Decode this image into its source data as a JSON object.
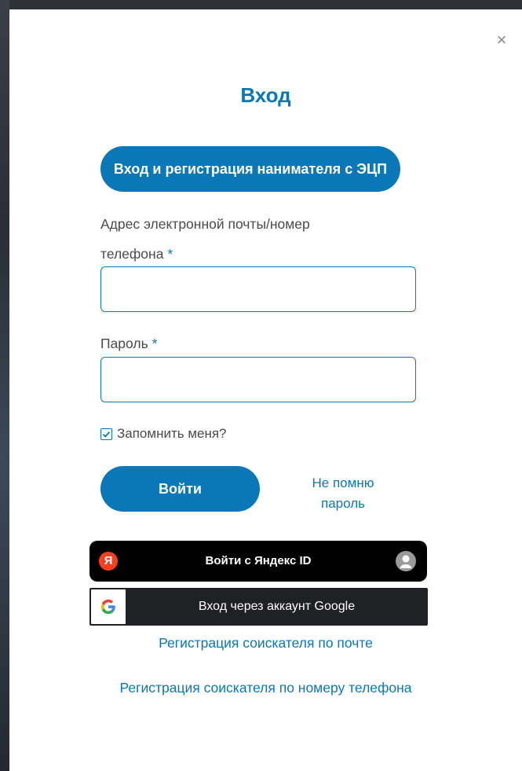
{
  "modal": {
    "close_symbol": "×",
    "title": "Вход",
    "ecp_button_label": "Вход и регистрация нанимателя с ЭЦП",
    "email_label_line1": "Адрес электронной почты/номер",
    "email_label_line2": "телефона",
    "required_mark": "*",
    "email_value": "",
    "password_label": "Пароль",
    "password_value": "",
    "remember": {
      "label": "Запомнить меня?",
      "checked": true
    },
    "login_button_label": "Войти",
    "forgot_line1": "Не помню",
    "forgot_line2": "пароль",
    "yandex": {
      "logo_letter": "Я",
      "label": "Войти с Яндекс ID",
      "avatar_icon": "user-avatar-icon"
    },
    "google": {
      "logo_letter": "G",
      "label": "Вход через аккаунт Google"
    },
    "register_email_link": "Регистрация соискателя по почте",
    "register_phone_link": "Регистрация соискателя по номеру телефона"
  },
  "colors": {
    "accent": "#0a77b9",
    "yandex_red": "#fc3f1d",
    "yandex_bg": "#000000",
    "google_bg": "#202124"
  }
}
